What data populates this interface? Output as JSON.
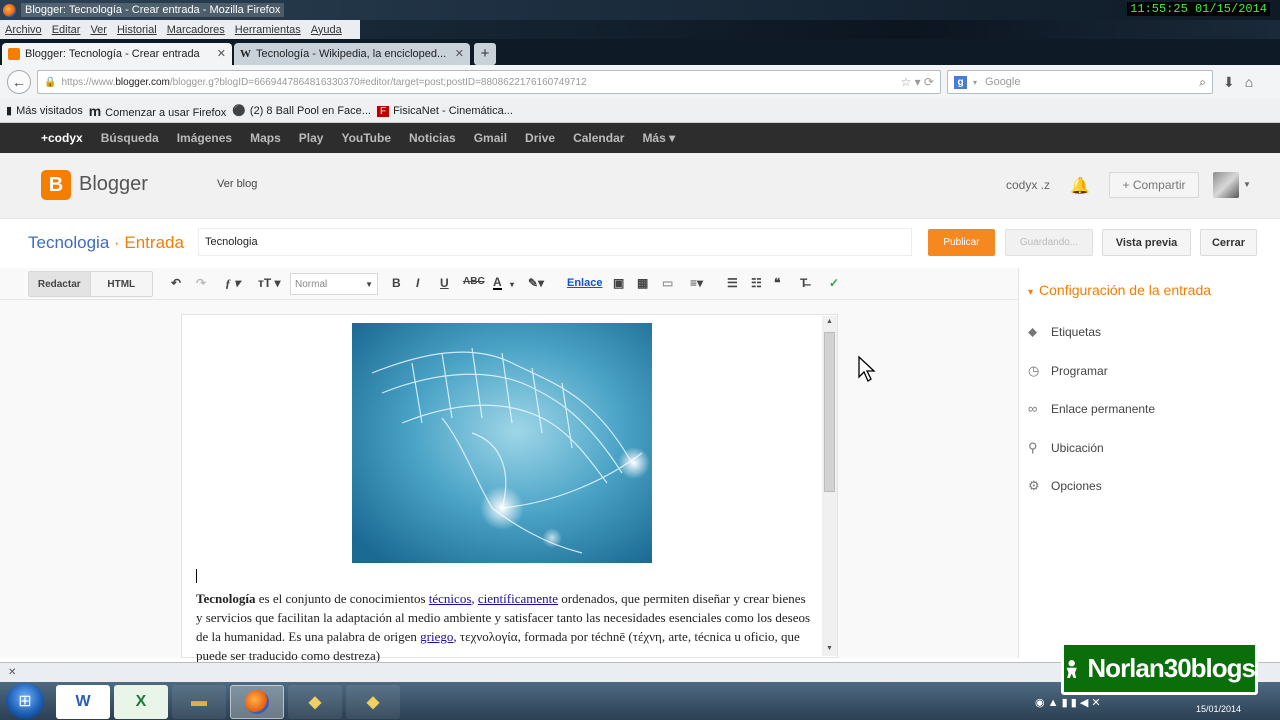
{
  "window": {
    "title": "Blogger: Tecnología - Crear entrada - Mozilla Firefox",
    "clock": "11:55:25  01/15/2014"
  },
  "menubar": [
    "Archivo",
    "Editar",
    "Ver",
    "Historial",
    "Marcadores",
    "Herramientas",
    "Ayuda"
  ],
  "tabs": [
    {
      "label": "Blogger: Tecnología - Crear entrada",
      "icon": "blogger-favicon",
      "active": true
    },
    {
      "label": "Tecnología - Wikipedia, la encicloped...",
      "icon": "wikipedia-favicon",
      "active": false
    }
  ],
  "nav": {
    "url_prefix": "https://www.",
    "url_domain": "blogger.com",
    "url_rest": "/blogger.g?blogID=6669447864816330370#editor/target=post;postID=8808622176160749712",
    "search_placeholder": "Google"
  },
  "bookmarks": [
    {
      "label": "Más visitados",
      "icon": "bookmark-icon"
    },
    {
      "label": "Comenzar a usar Firefox",
      "icon": "m-icon"
    },
    {
      "label": "(2) 8 Ball Pool en Face...",
      "icon": "pool-icon"
    },
    {
      "label": "FisicaNet - Cinemática...",
      "icon": "fisicanet-icon"
    }
  ],
  "google_bar": [
    "+codyx",
    "Búsqueda",
    "Imágenes",
    "Maps",
    "Play",
    "YouTube",
    "Noticias",
    "Gmail",
    "Drive",
    "Calendar",
    "Más ▾"
  ],
  "blogger": {
    "brand": "Blogger",
    "ver_blog": "Ver blog",
    "user": "codyx .z",
    "share": "+ Compartir"
  },
  "post": {
    "crumb_blog": "Tecnologia",
    "crumb_sep": " · ",
    "crumb_page": "Entrada",
    "title_value": "Tecnologia",
    "publish": "Publicar",
    "saving": "Guardando...",
    "preview": "Vista previa",
    "close": "Cerrar"
  },
  "toolbar": {
    "compose": "Redactar",
    "html": "HTML",
    "format": "Normal",
    "link": "Enlace"
  },
  "content": {
    "p1_bold": "Tecnología",
    "p1_a": " es el conjunto de conocimientos ",
    "link1": "técnicos",
    "p1_b": ", ",
    "link2": "científicamente",
    "p1_c": " ordenados, que permiten diseñar y crear bienes y servicios que facilitan la adaptación al medio ambiente y satisfacer tanto las necesidades esenciales como los deseos de la humanidad. Es una palabra de origen ",
    "link3": "griego",
    "p1_d": ", τεχνολογία, formada por téchnē (τέχνη, arte, técnica u oficio, que puede ser traducido como destreza)"
  },
  "sidebar": {
    "heading": "Configuración de la entrada",
    "items": [
      {
        "label": "Etiquetas",
        "icon": "tag-icon"
      },
      {
        "label": "Programar",
        "icon": "clock-icon"
      },
      {
        "label": "Enlace permanente",
        "icon": "link-icon"
      },
      {
        "label": "Ubicación",
        "icon": "location-icon"
      },
      {
        "label": "Opciones",
        "icon": "gear-icon"
      }
    ]
  },
  "taskbar": {
    "apps": [
      "Word",
      "Excel",
      "Explorador",
      "Firefox",
      "App",
      "App"
    ],
    "date": "15/01/2014"
  },
  "overlay": {
    "text": "Norlan30blogs"
  },
  "colors": {
    "accent": "#f57d00",
    "link": "#1a0dab",
    "blue": "#3b6cc7"
  }
}
